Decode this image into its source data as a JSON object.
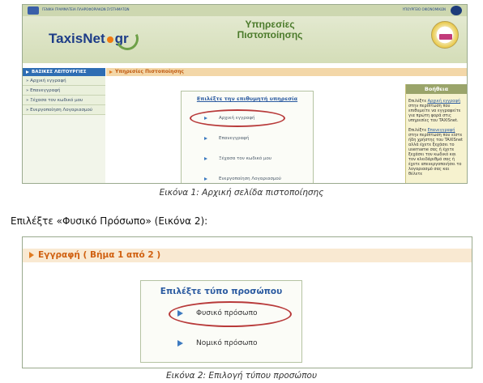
{
  "figure1": {
    "header": {
      "gov_text": "ΓΕΝΙΚΗ ΓΡΑΜΜΑΤΕΙΑ ΠΛΗΡΟΦΟΡΙΑΚΩΝ ΣΥΣΤΗΜΑΤΩΝ",
      "ministry_text": "ΥΠΟΥΡΓΕΙΟ ΟΙΚΟΝΟΜΙΚΩΝ",
      "logo_main": "TaxisNet",
      "logo_suffix": "gr",
      "title_line1": "Υπηρεσίες",
      "title_line2": "Πιστοποίησης"
    },
    "nav": {
      "sidebar_heading": "ΒΑΣΙΚΕΣ ΛΕΙΤΟΥΡΓΙΕΣ",
      "breadcrumb": "Υπηρεσίες Πιστοποίησης"
    },
    "sidebar_items": [
      {
        "label": "Αρχική εγγραφή"
      },
      {
        "label": "Επανεγγραφή"
      },
      {
        "label": "Ξέχασα τον κωδικό μου"
      },
      {
        "label": "Ενεργοποίηση Λογαριασμού"
      }
    ],
    "choices": {
      "title": "Επιλέξτε την επιθυμητή υπηρεσία",
      "items": [
        {
          "label": "Αρχική εγγραφή"
        },
        {
          "label": "Επανεγγραφή"
        },
        {
          "label": "Ξέχασα τον κωδικό μου"
        },
        {
          "label": "Ενεργοποίηση Λογαριασμού"
        }
      ]
    },
    "help": {
      "title": "Βοήθεια",
      "p1_before": "Επιλέξτε ",
      "p1_link": "Αρχική εγγραφή",
      "p1_after": " στην περίπτωση που επιθυμείτε να εγγραφείτε για πρώτη φορά στις υπηρεσίες του TAXISnet.",
      "p2_before": "Επιλέξτε ",
      "p2_link": "Επανεγγραφή",
      "p2_after": " στην περίπτωση που είστε ήδη χρήστης του TAXISnet αλλά έχετε ξεχάσει το username σας ή έχετε ξεχάσει τον κωδικό και τον κλειδάριθμό σας ή έχετε απενεργοποιήσει το λογαριασμό σας και θέλετε"
    },
    "caption": "Εικόνα 1: Αρχική σελίδα πιστοποίησης"
  },
  "instruction": "Επιλέξτε «Φυσικό Πρόσωπο» (Εικόνα 2):",
  "figure2": {
    "title": "Εγγραφή ( Βήμα 1 από 2 )",
    "box_title": "Επιλέξτε τύπο προσώπου",
    "options": [
      {
        "label": "Φυσικό πρόσωπο"
      },
      {
        "label": "Νομικό πρόσωπο"
      }
    ],
    "caption": "Εικόνα 2: Επιλογή τύπου προσώπου"
  },
  "colors": {
    "highlight_ellipse": "#b83a3a",
    "accent_orange": "#d06010",
    "link_blue": "#2a5aa0"
  }
}
